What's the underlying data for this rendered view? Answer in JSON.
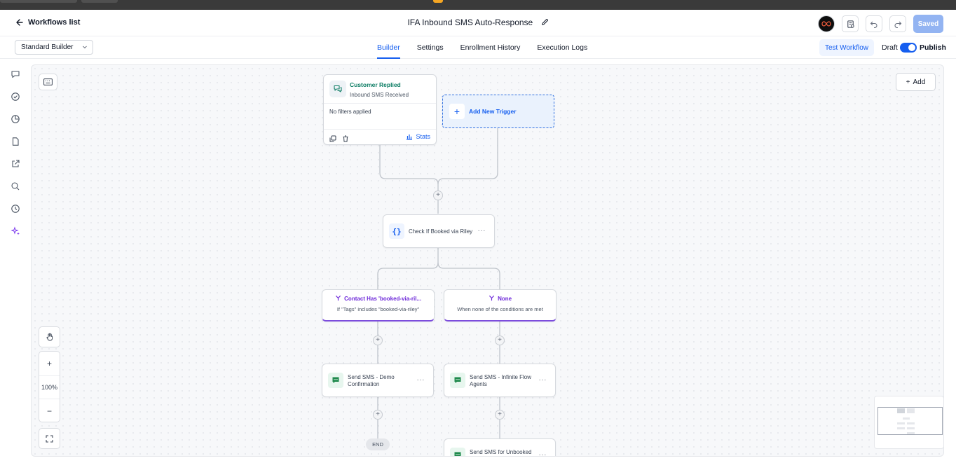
{
  "header": {
    "back_label": "Workflows list",
    "workflow_title": "IFA Inbound SMS Auto-Response",
    "saved_label": "Saved"
  },
  "subbar": {
    "builder_select_value": "Standard Builder",
    "tabs": [
      {
        "label": "Builder",
        "active": true
      },
      {
        "label": "Settings",
        "active": false
      },
      {
        "label": "Enrollment History",
        "active": false
      },
      {
        "label": "Execution Logs",
        "active": false
      }
    ],
    "test_workflow_label": "Test Workflow",
    "draft_label": "Draft",
    "publish_label": "Publish",
    "publish_toggle_on": true
  },
  "canvas": {
    "add_label": "Add",
    "zoom_level": "100%",
    "trigger": {
      "name": "Customer Replied",
      "subtitle": "Inbound SMS Received",
      "filters_text": "No filters applied",
      "stats_label": "Stats"
    },
    "new_trigger_label": "Add New Trigger",
    "condition_node": {
      "label": "Check If Booked via Riley"
    },
    "branches": [
      {
        "title": "Contact Has 'booked-via-ril...",
        "subtitle": "If \"Tags\" includes \"booked-via-riley\""
      },
      {
        "title": "None",
        "subtitle": "When none of the conditions are met"
      }
    ],
    "actions": [
      {
        "label_line1": "Send SMS - Demo",
        "label_line2": "Confirmation"
      },
      {
        "label_line1": "Send SMS - Infinite Flow",
        "label_line2": "Agents"
      },
      {
        "label_line1": "Send SMS for Unbooked",
        "label_line2": ""
      }
    ],
    "end_label": "END"
  },
  "colors": {
    "accent": "#155eef",
    "trigger_green": "#0b7c63",
    "branch_purple": "#6d28d9",
    "sms_green": "#1f8a4c"
  }
}
